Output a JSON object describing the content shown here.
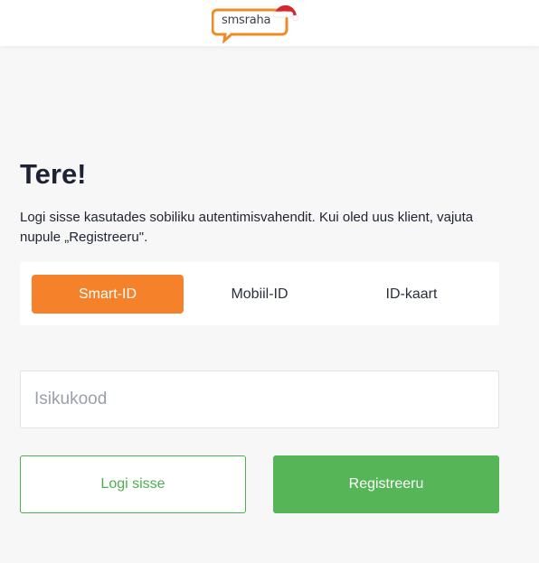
{
  "header": {
    "logo_text": "smsraha"
  },
  "login": {
    "title": "Tere!",
    "intro": "Logi sisse kasutades sobiliku autentimisvahendit. Kui oled uus klient, vajuta nupule „Registreeru\".",
    "tabs": [
      {
        "label": "Smart-ID",
        "active": true
      },
      {
        "label": "Mobiil-ID",
        "active": false
      },
      {
        "label": "ID-kaart",
        "active": false
      }
    ],
    "id_input": {
      "placeholder": "Isikukood",
      "value": ""
    },
    "login_button": "Logi sisse",
    "register_button": "Registreeru"
  },
  "colors": {
    "accent_orange": "#f5822a",
    "primary_green": "#55b557",
    "text_dark": "#1e2333",
    "background": "#f7f7f7"
  }
}
